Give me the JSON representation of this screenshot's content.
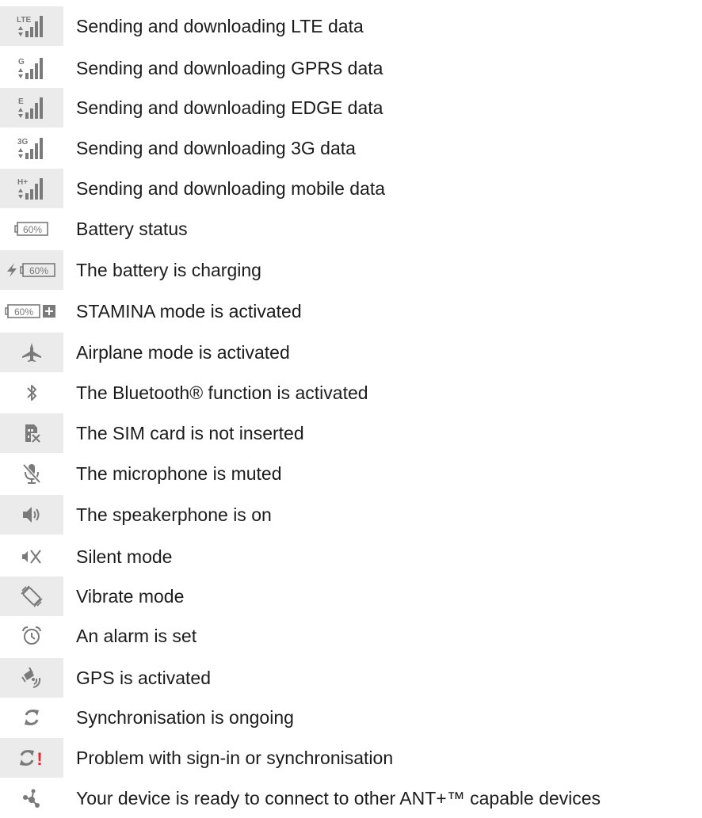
{
  "rows": [
    {
      "icon": "lte-signal-icon",
      "icon_text": "LTE",
      "label": "Sending and downloading LTE data",
      "shaded": true
    },
    {
      "icon": "gprs-signal-icon",
      "icon_text": "G",
      "label": "Sending and downloading GPRS data",
      "shaded": false
    },
    {
      "icon": "edge-signal-icon",
      "icon_text": "E",
      "label": "Sending and downloading EDGE data",
      "shaded": true
    },
    {
      "icon": "3g-signal-icon",
      "icon_text": "3G",
      "label": "Sending and downloading 3G data",
      "shaded": false
    },
    {
      "icon": "hplus-signal-icon",
      "icon_text": "H+",
      "label": "Sending and downloading mobile data",
      "shaded": true
    },
    {
      "icon": "battery-icon",
      "icon_text": "60%",
      "label": "Battery status",
      "shaded": false
    },
    {
      "icon": "battery-charging-icon",
      "icon_text": "60%",
      "label": "The battery is charging",
      "shaded": true
    },
    {
      "icon": "battery-stamina-icon",
      "icon_text": "60%",
      "label": "STAMINA mode is activated",
      "shaded": false
    },
    {
      "icon": "airplane-icon",
      "label": "Airplane mode is activated",
      "shaded": true
    },
    {
      "icon": "bluetooth-icon",
      "label": "The Bluetooth® function is activated",
      "shaded": false
    },
    {
      "icon": "sim-missing-icon",
      "label": "The SIM card is not inserted",
      "shaded": true
    },
    {
      "icon": "mic-muted-icon",
      "label": "The microphone is muted",
      "shaded": false
    },
    {
      "icon": "speakerphone-icon",
      "label": "The speakerphone is on",
      "shaded": true
    },
    {
      "icon": "silent-mode-icon",
      "label": "Silent mode",
      "shaded": false
    },
    {
      "icon": "vibrate-mode-icon",
      "label": "Vibrate mode",
      "shaded": true
    },
    {
      "icon": "alarm-icon",
      "label": "An alarm is set",
      "shaded": false
    },
    {
      "icon": "gps-icon",
      "label": "GPS is activated",
      "shaded": true
    },
    {
      "icon": "sync-icon",
      "label": "Synchronisation is ongoing",
      "shaded": false
    },
    {
      "icon": "sync-problem-icon",
      "icon_text": "!",
      "label": "Problem with sign-in or synchronisation",
      "shaded": true
    },
    {
      "icon": "ant-plus-icon",
      "label": "Your device is ready to connect  to other ANT+™ capable devices",
      "shaded": false
    }
  ],
  "colors": {
    "icon": "#7a7a7a",
    "shade": "#ebebeb",
    "alert": "#e3262b",
    "text": "#1c1c1c"
  }
}
